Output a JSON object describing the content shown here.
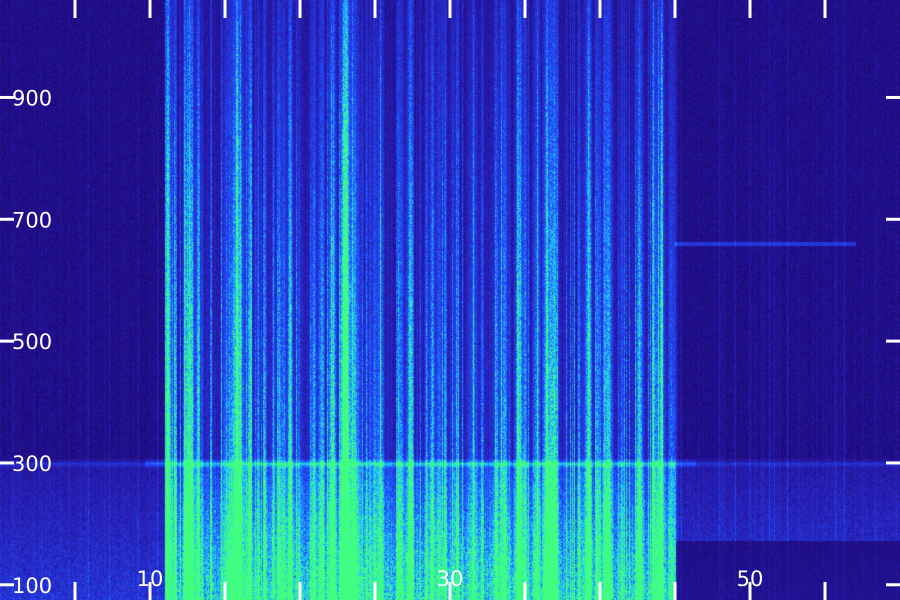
{
  "chart_data": {
    "type": "heatmap",
    "title": "",
    "xlabel": "",
    "ylabel": "",
    "xlim": [
      0,
      60
    ],
    "ylim": [
      75,
      1060
    ],
    "x_tick_labels": [
      "10",
      "30",
      "50"
    ],
    "x_tick_values": [
      10,
      30,
      50
    ],
    "x_tick_marks": [
      5,
      10,
      15,
      20,
      25,
      30,
      35,
      40,
      45,
      50,
      55
    ],
    "y_tick_labels": [
      "100",
      "300",
      "500",
      "700",
      "900"
    ],
    "y_tick_values": [
      100,
      300,
      500,
      700,
      900
    ],
    "colormap": [
      "#1a0060",
      "#2820b8",
      "#2050ff",
      "#20c8ff",
      "#40ff80"
    ],
    "background_color": "#1a0060",
    "grid": false,
    "legend": "none",
    "features": {
      "bright_horizontal_band_y": 300,
      "dense_activity_x_range": [
        11,
        45
      ],
      "low_frequency_energy_y_range": [
        75,
        300
      ],
      "faint_tone_y": 660,
      "faint_tone_x_range": [
        45,
        57
      ]
    }
  }
}
